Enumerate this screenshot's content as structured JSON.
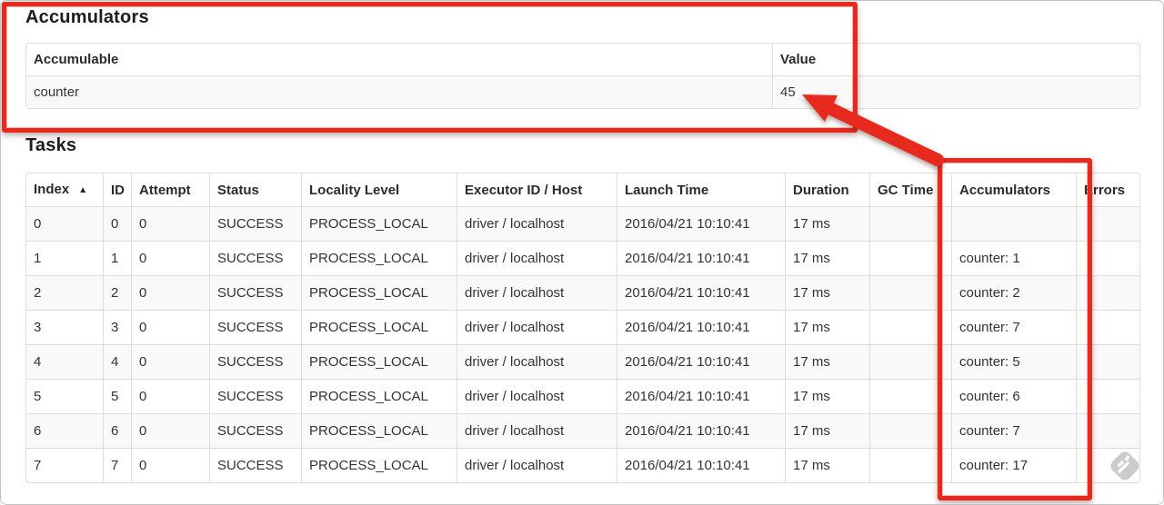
{
  "accumulators_section": {
    "title": "Accumulators",
    "table": {
      "columns": [
        "Accumulable",
        "Value"
      ],
      "rows": [
        {
          "accumulable": "counter",
          "value": "45"
        }
      ]
    }
  },
  "tasks_section": {
    "title": "Tasks",
    "table": {
      "columns": [
        "Index",
        "ID",
        "Attempt",
        "Status",
        "Locality Level",
        "Executor ID / Host",
        "Launch Time",
        "Duration",
        "GC Time",
        "Accumulators",
        "Errors"
      ],
      "sort_icon": "▲",
      "sorted_column": "Index",
      "rows": [
        {
          "index": "0",
          "id": "0",
          "attempt": "0",
          "status": "SUCCESS",
          "locality": "PROCESS_LOCAL",
          "executor": "driver / localhost",
          "launch": "2016/04/21 10:10:41",
          "duration": "17 ms",
          "gc_time": "",
          "accumulators": "",
          "errors": ""
        },
        {
          "index": "1",
          "id": "1",
          "attempt": "0",
          "status": "SUCCESS",
          "locality": "PROCESS_LOCAL",
          "executor": "driver / localhost",
          "launch": "2016/04/21 10:10:41",
          "duration": "17 ms",
          "gc_time": "",
          "accumulators": "counter: 1",
          "errors": ""
        },
        {
          "index": "2",
          "id": "2",
          "attempt": "0",
          "status": "SUCCESS",
          "locality": "PROCESS_LOCAL",
          "executor": "driver / localhost",
          "launch": "2016/04/21 10:10:41",
          "duration": "17 ms",
          "gc_time": "",
          "accumulators": "counter: 2",
          "errors": ""
        },
        {
          "index": "3",
          "id": "3",
          "attempt": "0",
          "status": "SUCCESS",
          "locality": "PROCESS_LOCAL",
          "executor": "driver / localhost",
          "launch": "2016/04/21 10:10:41",
          "duration": "17 ms",
          "gc_time": "",
          "accumulators": "counter: 7",
          "errors": ""
        },
        {
          "index": "4",
          "id": "4",
          "attempt": "0",
          "status": "SUCCESS",
          "locality": "PROCESS_LOCAL",
          "executor": "driver / localhost",
          "launch": "2016/04/21 10:10:41",
          "duration": "17 ms",
          "gc_time": "",
          "accumulators": "counter: 5",
          "errors": ""
        },
        {
          "index": "5",
          "id": "5",
          "attempt": "0",
          "status": "SUCCESS",
          "locality": "PROCESS_LOCAL",
          "executor": "driver / localhost",
          "launch": "2016/04/21 10:10:41",
          "duration": "17 ms",
          "gc_time": "",
          "accumulators": "counter: 6",
          "errors": ""
        },
        {
          "index": "6",
          "id": "6",
          "attempt": "0",
          "status": "SUCCESS",
          "locality": "PROCESS_LOCAL",
          "executor": "driver / localhost",
          "launch": "2016/04/21 10:10:41",
          "duration": "17 ms",
          "gc_time": "",
          "accumulators": "counter: 7",
          "errors": ""
        },
        {
          "index": "7",
          "id": "7",
          "attempt": "0",
          "status": "SUCCESS",
          "locality": "PROCESS_LOCAL",
          "executor": "driver / localhost",
          "launch": "2016/04/21 10:10:41",
          "duration": "17 ms",
          "gc_time": "",
          "accumulators": "counter: 17",
          "errors": ""
        }
      ]
    }
  },
  "annotations": {
    "color": "#e8291d",
    "highlighted_value": "45",
    "highlighted_column": "Accumulators"
  },
  "icons": {
    "sort_ascending": "sort-ascending-icon",
    "watermark": "feedly-watermark-icon"
  },
  "colors": {
    "annotation_red": "#e8291d",
    "table_border": "#dddddd",
    "row_stripe": "#f9f9f9",
    "watermark_gray": "#cbcbcb"
  }
}
